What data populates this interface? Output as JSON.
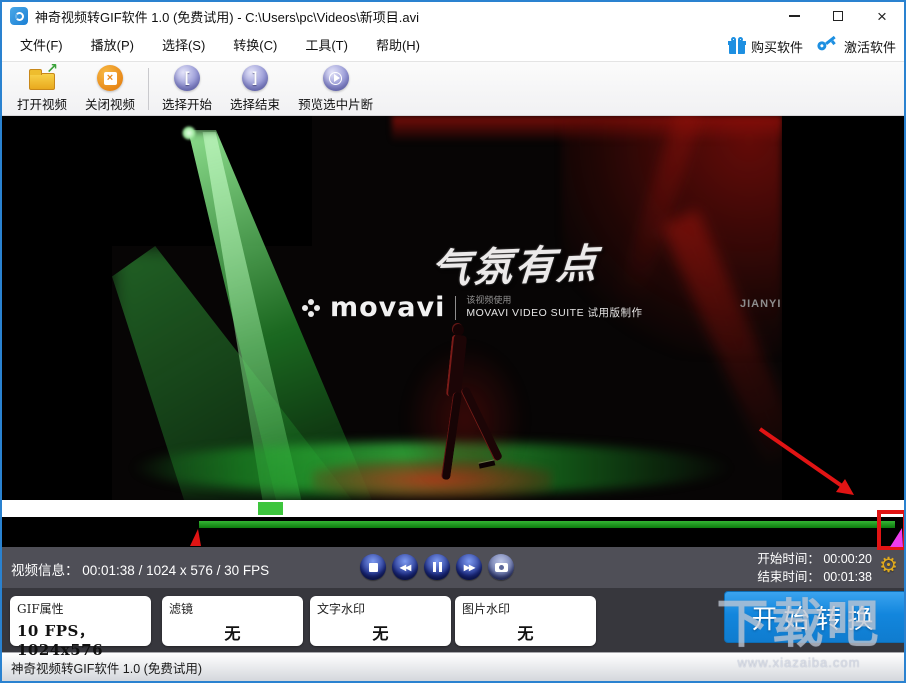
{
  "titlebar": {
    "title": "神奇视频转GIF软件 1.0 (免费试用) - C:\\Users\\pc\\Videos\\新项目.avi"
  },
  "menubar": {
    "items": [
      {
        "label": "文件(F)"
      },
      {
        "label": "播放(P)"
      },
      {
        "label": "选择(S)"
      },
      {
        "label": "转换(C)"
      },
      {
        "label": "工具(T)"
      },
      {
        "label": "帮助(H)"
      }
    ],
    "buy_label": "购买软件",
    "activate_label": "激活软件"
  },
  "toolbar": {
    "open": "打开视频",
    "close": "关闭视频",
    "select_start": "选择开始",
    "select_end": "选择结束",
    "preview": "预览选中片断"
  },
  "video": {
    "overlay_title": "气氛有点",
    "movavi_logo": "movavi",
    "watermark_line1": "该视频使用",
    "watermark_line2": "MOVAVI VIDEO SUITE 试用版制作",
    "corner_text": "JIANYI"
  },
  "infobar": {
    "info_label": "视频信息：",
    "info_value": "00:01:38 / 1024 x 576 / 30 FPS",
    "start_label": "开始时间：",
    "start_value": "00:00:20",
    "end_label": "结束时间：",
    "end_value": "00:01:38"
  },
  "panels": {
    "gif": {
      "label": "GIF属性",
      "value": "10 FPS， 1024x576"
    },
    "filter": {
      "label": "滤镜",
      "value": "无"
    },
    "text_wm": {
      "label": "文字水印",
      "value": "无"
    },
    "image_wm": {
      "label": "图片水印",
      "value": "无"
    }
  },
  "convert": {
    "label": "开始转换"
  },
  "statusbar": {
    "text": "神奇视频转GIF软件 1.0 (免费试用)"
  },
  "site_watermark": {
    "line1": "下载吧",
    "line2": "www.xiazaiba.com"
  },
  "icons": {
    "rewind": "◀◀",
    "forward": "▶▶",
    "gear": "⚙",
    "window_close": "×",
    "close_video_x": "×",
    "bracket_left": "[",
    "bracket_right": "]",
    "folder_arrow": "↗"
  },
  "colors": {
    "accent_blue": "#1d8fe1",
    "convert_blue": "#1286dd",
    "timeline_green": "#15921a",
    "seek_green": "#3dc53d",
    "annotation_red": "#e11414",
    "marker_magenta": "#ee3cee",
    "gear_gold": "#dfa91e"
  }
}
